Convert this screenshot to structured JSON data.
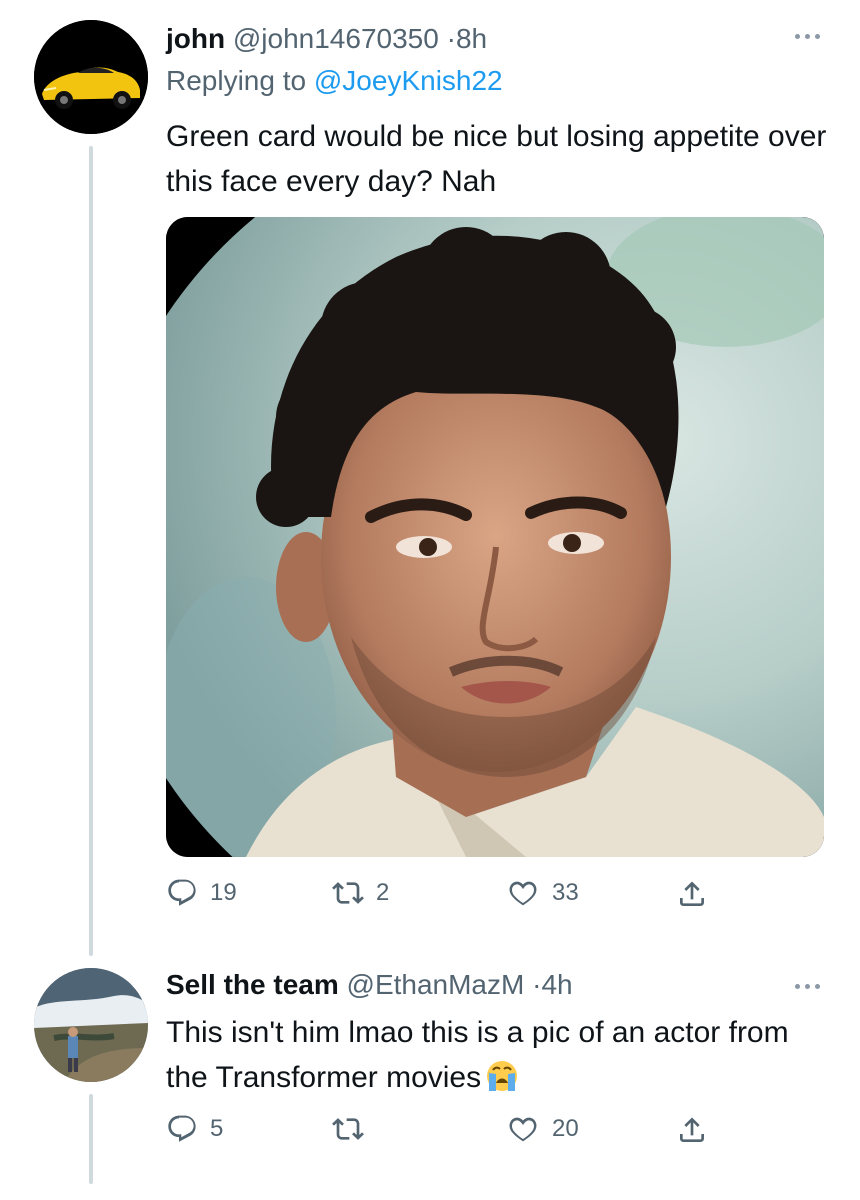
{
  "tweet1": {
    "name": "john",
    "handle": "@john14670350",
    "separator": "·",
    "time": "8h",
    "replying_prefix": "Replying to ",
    "replying_to": "@JoeyKnish22",
    "text": "Green card would be nice but losing appetite over this face every day? Nah",
    "replies": "19",
    "retweets": "2",
    "likes": "33"
  },
  "tweet2": {
    "name": "Sell the team",
    "handle": "@EthanMazM",
    "separator": "·",
    "time": "4h",
    "text": "This isn't him lmao this is a pic of an actor from the Transformer movies",
    "emoji": "crying-face-emoji",
    "replies": "5",
    "likes": "20"
  },
  "colors": {
    "text": "#0f1419",
    "secondary": "#536471",
    "link": "#1d9bf0",
    "thread_line": "#cfd9de"
  },
  "icons": [
    "reply-icon",
    "retweet-icon",
    "like-icon",
    "share-icon",
    "more-icon"
  ]
}
